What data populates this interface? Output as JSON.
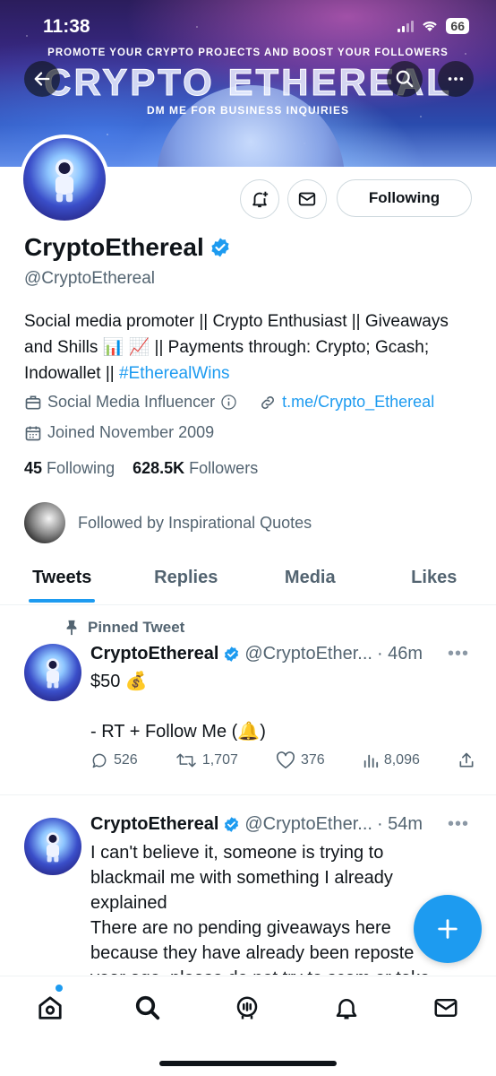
{
  "status_bar": {
    "time": "11:38",
    "battery": "66"
  },
  "banner": {
    "promo": "PROMOTE YOUR CRYPTO PROJECTS AND BOOST YOUR FOLLOWERS",
    "title": "CRYPTO ETHEREAL",
    "dm": "DM ME FOR BUSINESS INQUIRIES"
  },
  "profile": {
    "name": "CryptoEthereal",
    "handle": "@CryptoEthereal",
    "bio_text": "Social media promoter || Crypto Enthusiast || Giveaways and Shills 📊 📈 || Payments through: Crypto; Gcash; Indowallet || ",
    "bio_hashtag": "#EtherealWins",
    "category": "Social Media Influencer",
    "website": "t.me/Crypto_Ethereal",
    "joined": "Joined November 2009",
    "following_count": "45",
    "following_label": "Following",
    "followers_count": "628.5K",
    "followers_label": "Followers",
    "followed_by": "Followed by Inspirational Quotes",
    "following_button": "Following"
  },
  "tabs": [
    {
      "label": "Tweets",
      "active": true
    },
    {
      "label": "Replies",
      "active": false
    },
    {
      "label": "Media",
      "active": false
    },
    {
      "label": "Likes",
      "active": false
    }
  ],
  "tweets": [
    {
      "pinned_label": "Pinned Tweet",
      "name": "CryptoEthereal",
      "handle": "@CryptoEther...",
      "time": "· 46m",
      "line1": "$50 💰",
      "line2": "- RT + Follow Me (🔔)",
      "replies": "526",
      "retweets": "1,707",
      "likes": "376",
      "views": "8,096"
    },
    {
      "name": "CryptoEthereal",
      "handle": "@CryptoEther...",
      "time": "· 54m",
      "text_lines": [
        "I can't believe it, someone is trying to",
        "blackmail me with something I already",
        "explained",
        "There are no pending giveaways here",
        "because they have already been reposte",
        "year ago, please do not try to scam or take"
      ]
    }
  ],
  "colors": {
    "accent": "#1d9bf0",
    "text": "#0f1419",
    "muted": "#536471",
    "border": "#cfd9de"
  }
}
